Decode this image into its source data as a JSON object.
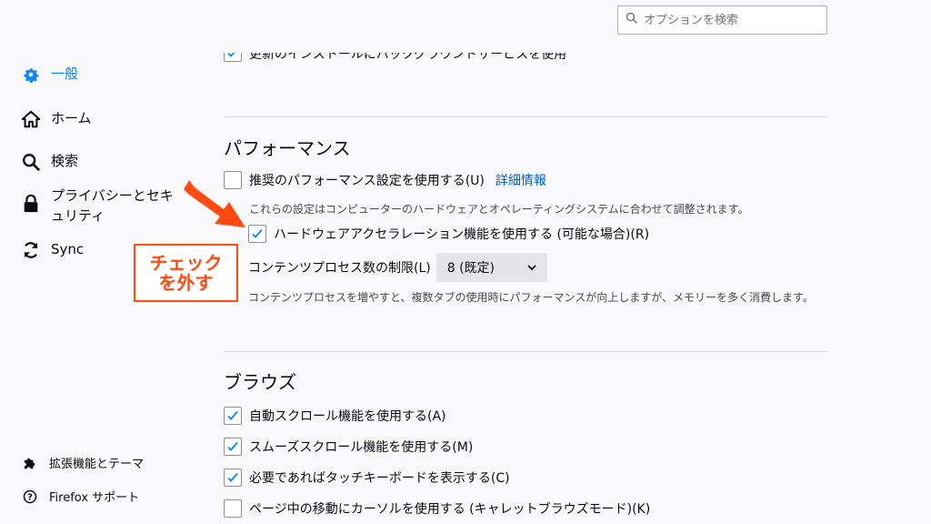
{
  "search": {
    "placeholder": "オプションを検索"
  },
  "sidebar": {
    "items": [
      {
        "label": "一般",
        "icon": "gear-icon"
      },
      {
        "label": "ホーム",
        "icon": "home-icon"
      },
      {
        "label": "検索",
        "icon": "search-icon"
      },
      {
        "label": "プライバシーとセキュリティ",
        "icon": "lock-icon"
      },
      {
        "label": "Sync",
        "icon": "sync-icon"
      }
    ],
    "bottom": [
      {
        "label": "拡張機能とテーマ",
        "icon": "puzzle-icon"
      },
      {
        "label": "Firefox サポート",
        "icon": "help-icon"
      }
    ]
  },
  "cut_row": {
    "label": "更新のインストールにバックグラウンドサービスを使用する(S)"
  },
  "performance": {
    "title": "パフォーマンス",
    "recommended": {
      "label": "推奨のパフォーマンス設定を使用する(U)",
      "link": "詳細情報",
      "checked": false
    },
    "recommended_desc": "これらの設定はコンピューターのハードウェアとオペレーティングシステムに合わせて調整されます。",
    "hw_accel": {
      "label": "ハードウェアアクセラレーション機能を使用する (可能な場合)(R)",
      "checked": true
    },
    "process_limit": {
      "label": "コンテンツプロセス数の制限(L)",
      "value": "8 (既定)"
    },
    "process_desc": "コンテンツプロセスを増やすと、複数タブの使用時にパフォーマンスが向上しますが、メモリーを多く消費します。"
  },
  "browsing": {
    "title": "ブラウズ",
    "items": [
      {
        "label": "自動スクロール機能を使用する(A)",
        "checked": true
      },
      {
        "label": "スムーズスクロール機能を使用する(M)",
        "checked": true
      },
      {
        "label": "必要であればタッチキーボードを表示する(C)",
        "checked": true
      },
      {
        "label": "ページ中の移動にカーソルを使用する (キャレットブラウズモード)(K)",
        "checked": false
      }
    ]
  },
  "annotation": {
    "line1": "チェック",
    "line2": "を外す",
    "color": "#ff4a12"
  },
  "colors": {
    "accent": "#0a84ff",
    "link": "#0060df"
  }
}
